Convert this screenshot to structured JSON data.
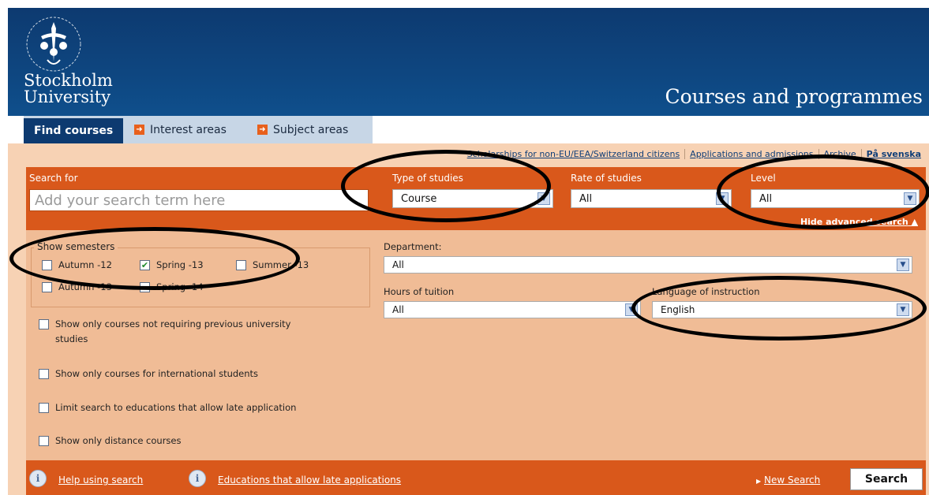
{
  "header": {
    "university_line1": "Stockholm",
    "university_line2": "University",
    "site_title": "Courses and programmes"
  },
  "tabs": [
    {
      "label": "Find courses",
      "active": true
    },
    {
      "label": "Interest areas",
      "active": false
    },
    {
      "label": "Subject areas",
      "active": false
    }
  ],
  "top_links": [
    "Scholarships for non-EU/EEA/Switzerland citizens",
    "Applications and admissions",
    "Archive",
    "På svenska"
  ],
  "search": {
    "label": "Search for",
    "placeholder": "Add your search term here",
    "type_label": "Type of studies",
    "type_value": "Course",
    "rate_label": "Rate of studies",
    "rate_value": "All",
    "level_label": "Level",
    "level_value": "All",
    "advanced_link": "Hide advanced search"
  },
  "semesters": {
    "legend": "Show semesters",
    "items": [
      {
        "label": "Autumn -12",
        "checked": false
      },
      {
        "label": "Spring -13",
        "checked": true
      },
      {
        "label": "Summer -13",
        "checked": false
      },
      {
        "label": "Autumn -13",
        "checked": false
      },
      {
        "label": "Spring -14",
        "checked": false
      }
    ]
  },
  "options": [
    {
      "label": "Show only courses not requiring previous university",
      "label2": "studies",
      "checked": false
    },
    {
      "label": "Show only courses for international students",
      "checked": false
    },
    {
      "label": "Limit search to educations that allow late application",
      "checked": false
    },
    {
      "label": "Show only distance courses",
      "checked": false
    }
  ],
  "filters": {
    "department_label": "Department:",
    "department_value": "All",
    "hours_label": "Hours of tuition",
    "hours_value": "All",
    "language_label": "Language of instruction",
    "language_value": "English"
  },
  "footer": {
    "help_link": "Help using search",
    "late_link": "Educations that allow late applications",
    "new_search": "New Search",
    "search_button": "Search"
  },
  "colors": {
    "header_blue": "#0d3a70",
    "accent_orange": "#d9581b",
    "panel_peach": "#f0bc96"
  }
}
